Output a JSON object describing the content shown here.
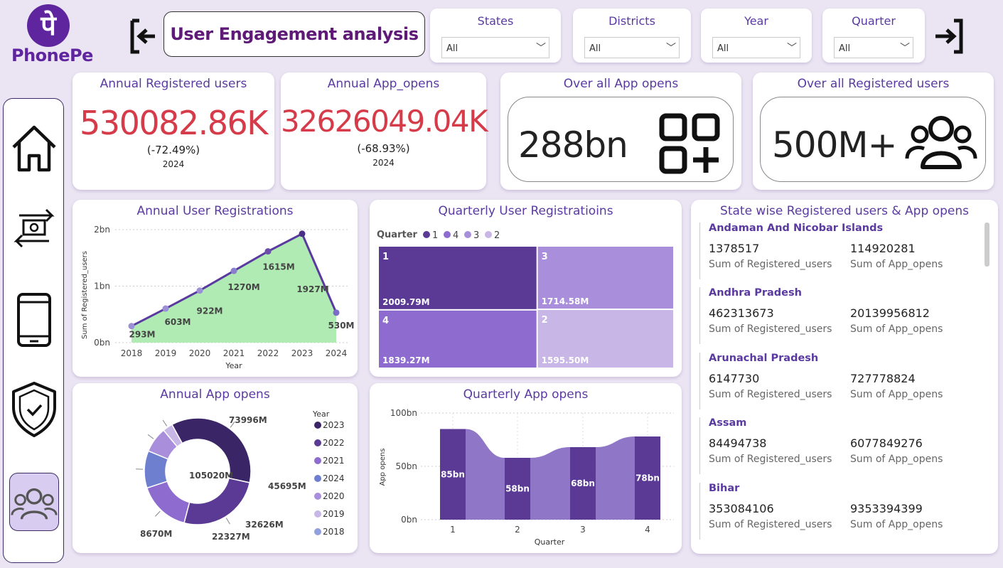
{
  "brand": {
    "name": "PhonePe",
    "logo_glyph": "पे",
    "color": "#5f259f"
  },
  "page_title": "User Engagement analysis",
  "filters": [
    {
      "label": "States",
      "value": "All"
    },
    {
      "label": "Districts",
      "value": "All"
    },
    {
      "label": "Year",
      "value": "All"
    },
    {
      "label": "Quarter",
      "value": "All"
    }
  ],
  "nav": {
    "back_icon": "exit-left-icon",
    "forward_icon": "enter-right-icon",
    "items": [
      "home-icon",
      "transactions-icon",
      "mobile-icon",
      "insurance-shield-icon",
      "users-icon"
    ],
    "active": "users-icon"
  },
  "kpis": {
    "annual_registered": {
      "title": "Annual Registered users",
      "value": "530082.86K",
      "change": "(-72.49%)",
      "year": "2024"
    },
    "annual_app_opens": {
      "title": "Annual App_opens",
      "value": "32626049.04K",
      "change": "(-68.93%)",
      "year": "2024"
    },
    "overall_app_opens": {
      "title": "Over all App opens",
      "value": "288bn"
    },
    "overall_registered": {
      "title": "Over all Registered users",
      "value": "500M+"
    }
  },
  "colors": {
    "accent": "#5a3aa0",
    "kpi_red": "#d63b4a",
    "area_fill": "#b0ebb4",
    "line": "#5a3aa0"
  },
  "annual_registrations": {
    "title": "Annual User Registrations",
    "xlabel": "Year",
    "ylabel": "Sum of Registered_users",
    "yticks": [
      "0bn",
      "1bn",
      "2bn"
    ],
    "chart_data": {
      "type": "area",
      "x": [
        "2018",
        "2019",
        "2020",
        "2021",
        "2022",
        "2023",
        "2024"
      ],
      "values": [
        293,
        603,
        922,
        1270,
        1615,
        1927,
        530
      ],
      "labels": [
        "293M",
        "603M",
        "922M",
        "1270M",
        "1615M",
        "1927M",
        "530M"
      ],
      "unit": "M",
      "ylim": [
        0,
        2000
      ]
    }
  },
  "quarterly_registrations": {
    "title": "Quarterly User Registratioins",
    "legend_title": "Quarter",
    "legend": [
      "1",
      "4",
      "3",
      "2"
    ],
    "chart_data": {
      "type": "treemap",
      "items": [
        {
          "quarter": "1",
          "label": "2009.79M",
          "value": 2009.79,
          "color": "#5a3a94"
        },
        {
          "quarter": "3",
          "label": "1714.58M",
          "value": 1714.58,
          "color": "#a98fdb"
        },
        {
          "quarter": "4",
          "label": "1839.27M",
          "value": 1839.27,
          "color": "#8e6ccf"
        },
        {
          "quarter": "2",
          "label": "1595.50M",
          "value": 1595.5,
          "color": "#c7b6e6"
        }
      ]
    }
  },
  "annual_app_opens": {
    "title": "Annual App opens",
    "legend_title": "Year",
    "chart_data": {
      "type": "donut",
      "slices": [
        {
          "name": "2023",
          "value": 105020,
          "label": "105020M",
          "color": "#3a2566"
        },
        {
          "name": "2022",
          "value": 73996,
          "label": "73996M",
          "color": "#5a3a94"
        },
        {
          "name": "2021",
          "value": 45695,
          "label": "45695M",
          "color": "#8e6ccf"
        },
        {
          "name": "2024",
          "value": 32626,
          "label": "32626M",
          "color": "#6f7fcf"
        },
        {
          "name": "2020",
          "value": 22327,
          "label": "22327M",
          "color": "#a98fdb"
        },
        {
          "name": "2019",
          "value": 8670,
          "label": "8670M",
          "color": "#c7b6e6"
        },
        {
          "name": "2018",
          "value": 0,
          "label": "",
          "color": "#8fa0dc"
        }
      ],
      "legend_order": [
        "2023",
        "2022",
        "2021",
        "2024",
        "2020",
        "2019",
        "2018"
      ]
    }
  },
  "quarterly_app_opens": {
    "title": "Quarterly App opens",
    "xlabel": "Quarter",
    "ylabel": "App opens",
    "yticks": [
      "0bn",
      "50bn",
      "100bn"
    ],
    "chart_data": {
      "type": "ribbon",
      "categories": [
        "1",
        "2",
        "3",
        "4"
      ],
      "values": [
        85,
        58,
        68,
        78
      ],
      "labels": [
        "85bn",
        "58bn",
        "68bn",
        "78bn"
      ],
      "unit": "bn",
      "ylim": [
        0,
        100
      ]
    }
  },
  "state_table": {
    "title": "State wise Registered users & App opens",
    "label_registered": "Sum of Registered_users",
    "label_opens": "Sum of App_opens",
    "rows": [
      {
        "state": "Andaman And Nicobar Islands",
        "registered": "1378517",
        "app_opens": "114920281"
      },
      {
        "state": "Andhra Pradesh",
        "registered": "462313673",
        "app_opens": "20139956812"
      },
      {
        "state": "Arunachal Pradesh",
        "registered": "6147730",
        "app_opens": "727778824"
      },
      {
        "state": "Assam",
        "registered": "84494738",
        "app_opens": "6077849276"
      },
      {
        "state": "Bihar",
        "registered": "353084106",
        "app_opens": "9353394399"
      }
    ]
  }
}
